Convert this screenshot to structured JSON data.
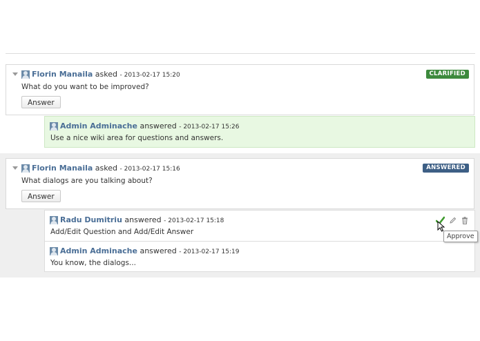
{
  "questions": [
    {
      "author": "Florin Manaila",
      "verb": "asked",
      "date": "- 2013-02-17 15:20",
      "text": "What do you want to be improved?",
      "answer_button": "Answer",
      "status": "CLARIFIED",
      "status_color": "#3d8a3d",
      "answers": [
        {
          "author": "Admin Adminache",
          "verb": "answered",
          "date": "- 2013-02-17 15:26",
          "text": "Use a nice wiki area for questions and answers."
        }
      ]
    },
    {
      "author": "Florin Manaila",
      "verb": "asked",
      "date": "- 2013-02-17 15:16",
      "text": "What dialogs are you talking about?",
      "answer_button": "Answer",
      "status": "ANSWERED",
      "status_color": "#3d5f85",
      "answers": [
        {
          "author": "Radu Dumitriu",
          "verb": "answered",
          "date": "- 2013-02-17 15:18",
          "text": "Add/Edit Question and Add/Edit Answer",
          "actions": {
            "approve_icon": "check-icon",
            "edit_icon": "pencil-icon",
            "delete_icon": "trash-icon"
          }
        },
        {
          "author": "Admin Adminache",
          "verb": "answered",
          "date": "- 2013-02-17 15:19",
          "text": "You know, the dialogs..."
        }
      ]
    }
  ],
  "tooltip": "Approve"
}
